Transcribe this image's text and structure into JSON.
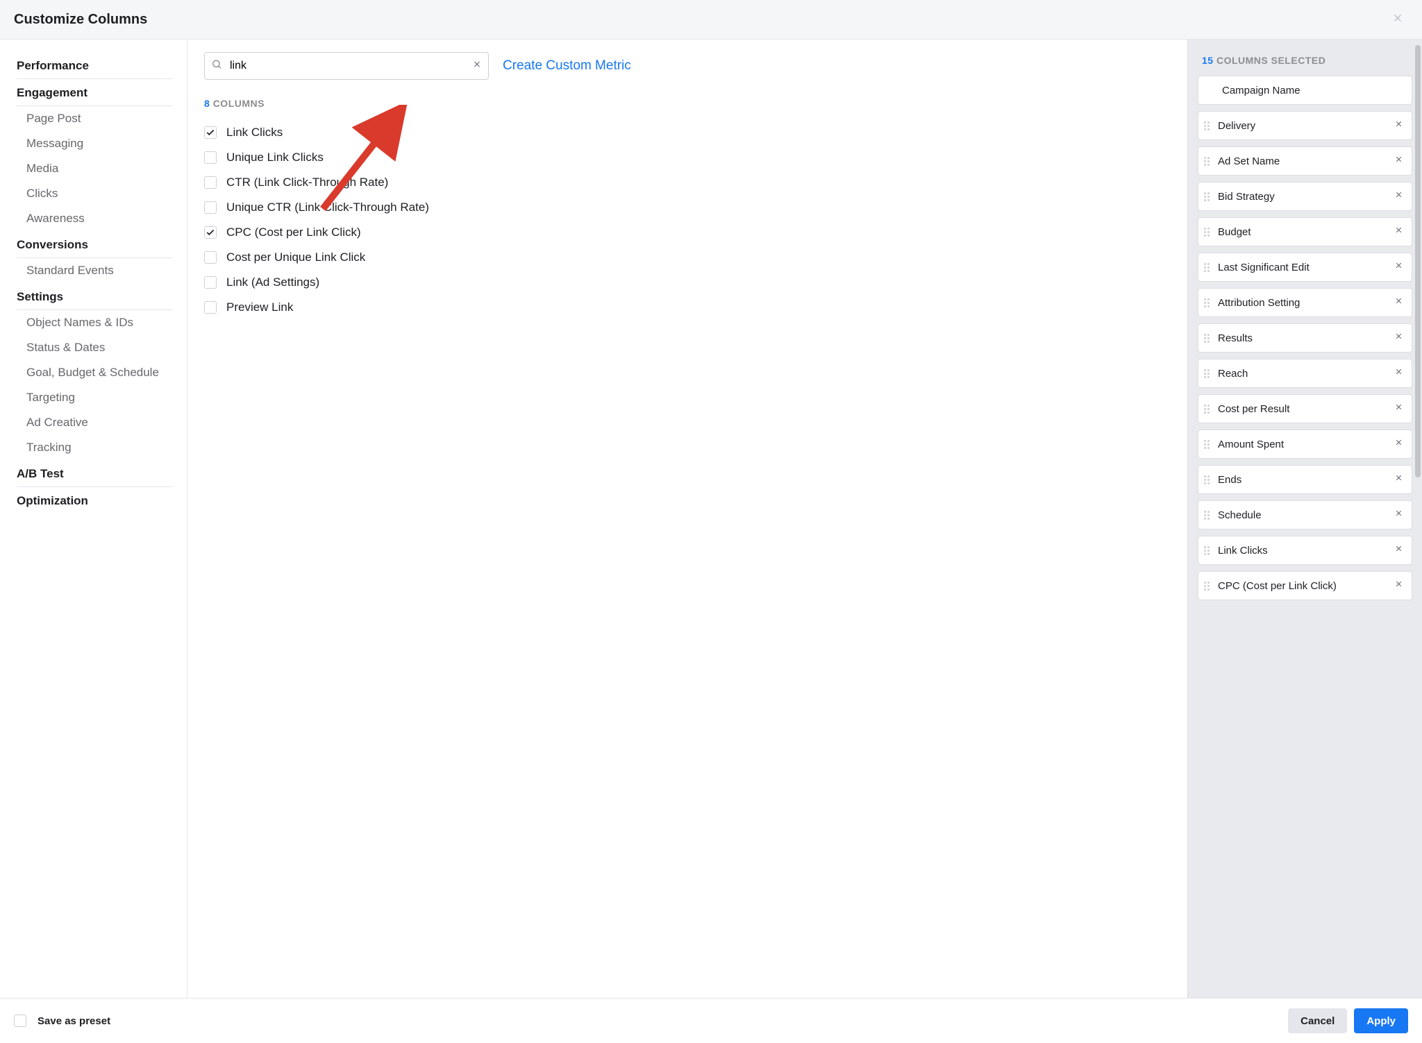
{
  "header": {
    "title": "Customize Columns"
  },
  "sidebar": {
    "groups": [
      {
        "heading": "Performance",
        "items": []
      },
      {
        "heading": "Engagement",
        "items": [
          "Page Post",
          "Messaging",
          "Media",
          "Clicks",
          "Awareness"
        ]
      },
      {
        "heading": "Conversions",
        "items": [
          "Standard Events"
        ]
      },
      {
        "heading": "Settings",
        "items": [
          "Object Names & IDs",
          "Status & Dates",
          "Goal, Budget & Schedule",
          "Targeting",
          "Ad Creative",
          "Tracking"
        ]
      },
      {
        "heading": "A/B Test",
        "items": []
      },
      {
        "heading": "Optimization",
        "items": []
      }
    ]
  },
  "search": {
    "value": "link"
  },
  "create_metric_label": "Create Custom Metric",
  "columns": {
    "count": "8",
    "label": "COLUMNS",
    "items": [
      {
        "label": "Link Clicks",
        "checked": true
      },
      {
        "label": "Unique Link Clicks",
        "checked": false
      },
      {
        "label": "CTR (Link Click-Through Rate)",
        "checked": false
      },
      {
        "label": "Unique CTR (Link Click-Through Rate)",
        "checked": false
      },
      {
        "label": "CPC (Cost per Link Click)",
        "checked": true
      },
      {
        "label": "Cost per Unique Link Click",
        "checked": false
      },
      {
        "label": "Link (Ad Settings)",
        "checked": false
      },
      {
        "label": "Preview Link",
        "checked": false
      }
    ]
  },
  "selected": {
    "count": "15",
    "label": "COLUMNS SELECTED",
    "items": [
      {
        "label": "Campaign Name",
        "fixed": true
      },
      {
        "label": "Delivery"
      },
      {
        "label": "Ad Set Name"
      },
      {
        "label": "Bid Strategy"
      },
      {
        "label": "Budget"
      },
      {
        "label": "Last Significant Edit"
      },
      {
        "label": "Attribution Setting"
      },
      {
        "label": "Results"
      },
      {
        "label": "Reach"
      },
      {
        "label": "Cost per Result"
      },
      {
        "label": "Amount Spent"
      },
      {
        "label": "Ends"
      },
      {
        "label": "Schedule"
      },
      {
        "label": "Link Clicks"
      },
      {
        "label": "CPC (Cost per Link Click)"
      }
    ]
  },
  "footer": {
    "save_preset": "Save as preset",
    "cancel": "Cancel",
    "apply": "Apply"
  },
  "colors": {
    "accent": "#1877f2",
    "arrow": "#d93a2b"
  }
}
